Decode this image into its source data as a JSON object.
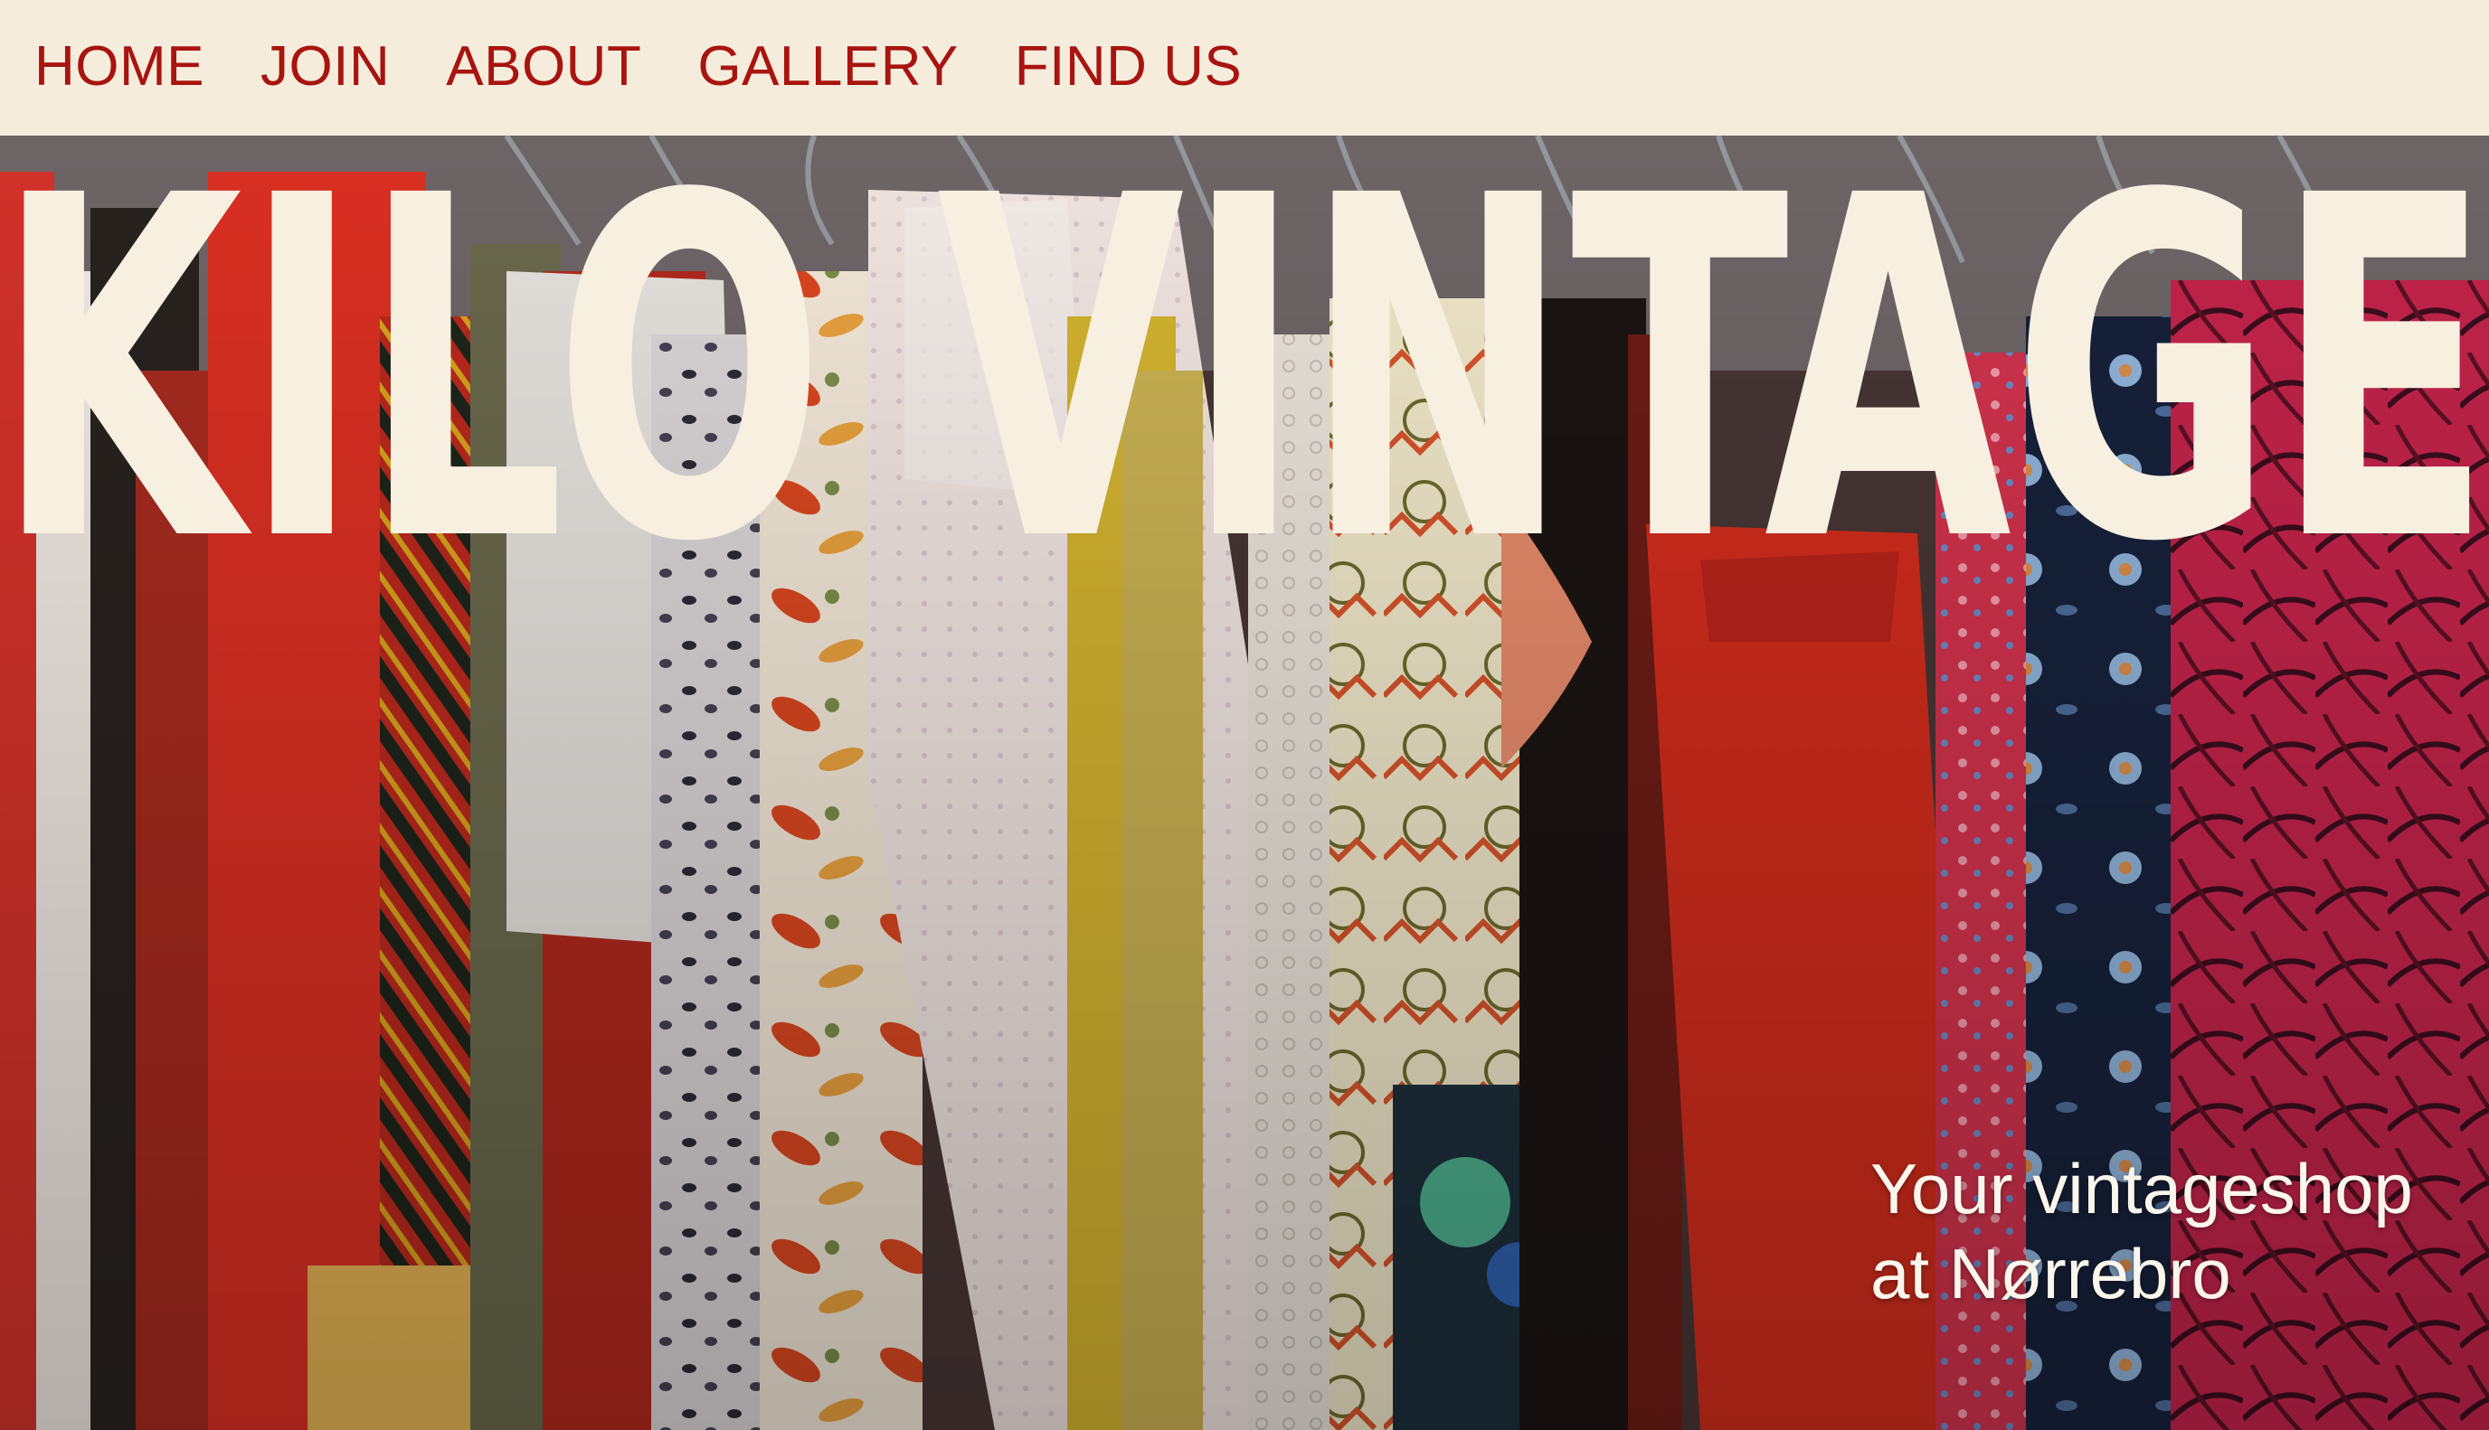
{
  "nav": {
    "items": [
      {
        "label": "HOME"
      },
      {
        "label": "JOIN"
      },
      {
        "label": "ABOUT"
      },
      {
        "label": "GALLERY"
      },
      {
        "label": "FIND US"
      }
    ]
  },
  "hero": {
    "title": "KILO VINTAGE",
    "tagline_line1": "Your vintageshop",
    "tagline_line2": "at Nørrebro"
  },
  "colors": {
    "nav_text": "#a8140f",
    "background": "#f5ecdc",
    "title_fill": "#f7efe0",
    "tagline_text": "#fbf6ec"
  }
}
